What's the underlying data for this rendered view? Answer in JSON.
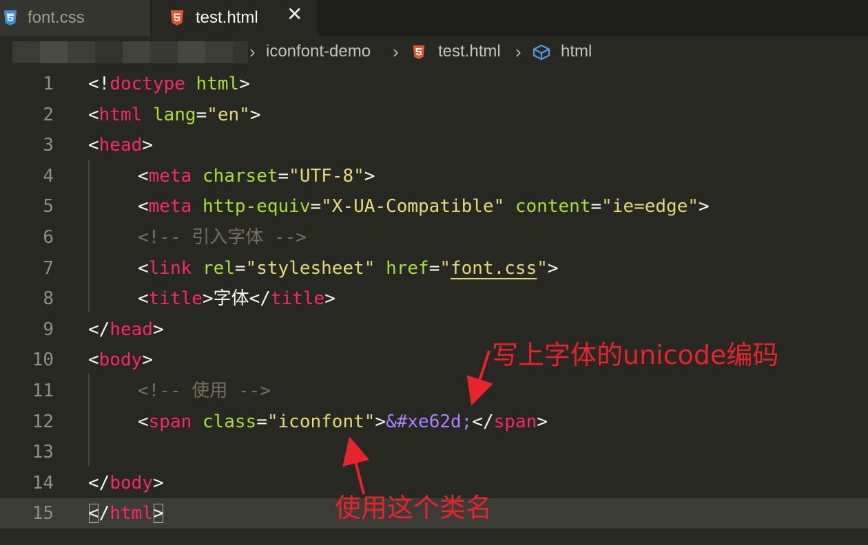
{
  "tabs": [
    {
      "label": "font.css",
      "icon": "css3-icon",
      "active": false
    },
    {
      "label": "test.html",
      "icon": "html5-icon",
      "active": true
    }
  ],
  "tab_close_glyph": "✕",
  "breadcrumb": {
    "items": [
      "iconfont-demo",
      "test.html",
      "html"
    ],
    "separator": "›"
  },
  "code_lines": [
    {
      "n": "1",
      "indent": 0,
      "tokens": [
        [
          "br",
          "<!"
        ],
        [
          "tag",
          "doctype"
        ],
        [
          "txt",
          " "
        ],
        [
          "attr",
          "html"
        ],
        [
          "br",
          ">"
        ]
      ]
    },
    {
      "n": "2",
      "indent": 0,
      "tokens": [
        [
          "br",
          "<"
        ],
        [
          "tag",
          "html"
        ],
        [
          "txt",
          " "
        ],
        [
          "attr",
          "lang"
        ],
        [
          "br",
          "="
        ],
        [
          "str",
          "\"en\""
        ],
        [
          "br",
          ">"
        ]
      ]
    },
    {
      "n": "3",
      "indent": 0,
      "tokens": [
        [
          "br",
          "<"
        ],
        [
          "tag",
          "head"
        ],
        [
          "br",
          ">"
        ]
      ]
    },
    {
      "n": "4",
      "indent": 1,
      "tokens": [
        [
          "br",
          "<"
        ],
        [
          "tag",
          "meta"
        ],
        [
          "txt",
          " "
        ],
        [
          "attr",
          "charset"
        ],
        [
          "br",
          "="
        ],
        [
          "str",
          "\"UTF-8\""
        ],
        [
          "br",
          ">"
        ]
      ]
    },
    {
      "n": "5",
      "indent": 1,
      "tokens": [
        [
          "br",
          "<"
        ],
        [
          "tag",
          "meta"
        ],
        [
          "txt",
          " "
        ],
        [
          "attr",
          "http-equiv"
        ],
        [
          "br",
          "="
        ],
        [
          "str",
          "\"X-UA-Compatible\""
        ],
        [
          "txt",
          " "
        ],
        [
          "attr",
          "content"
        ],
        [
          "br",
          "="
        ],
        [
          "str",
          "\"ie=edge\""
        ],
        [
          "br",
          ">"
        ]
      ]
    },
    {
      "n": "6",
      "indent": 1,
      "tokens": [
        [
          "com",
          "<!-- 引入字体 -->"
        ]
      ]
    },
    {
      "n": "7",
      "indent": 1,
      "tokens": [
        [
          "br",
          "<"
        ],
        [
          "tag",
          "link"
        ],
        [
          "txt",
          " "
        ],
        [
          "attr",
          "rel"
        ],
        [
          "br",
          "="
        ],
        [
          "str",
          "\"stylesheet\""
        ],
        [
          "txt",
          " "
        ],
        [
          "attr",
          "href"
        ],
        [
          "br",
          "="
        ],
        [
          "str",
          "\""
        ],
        [
          "strlink",
          "font.css"
        ],
        [
          "str",
          "\""
        ],
        [
          "br",
          ">"
        ]
      ]
    },
    {
      "n": "8",
      "indent": 1,
      "tokens": [
        [
          "br",
          "<"
        ],
        [
          "tag",
          "title"
        ],
        [
          "br",
          ">"
        ],
        [
          "txt",
          "字体"
        ],
        [
          "br",
          "</"
        ],
        [
          "tag",
          "title"
        ],
        [
          "br",
          ">"
        ]
      ]
    },
    {
      "n": "9",
      "indent": 0,
      "tokens": [
        [
          "br",
          "</"
        ],
        [
          "tag",
          "head"
        ],
        [
          "br",
          ">"
        ]
      ]
    },
    {
      "n": "10",
      "indent": 0,
      "tokens": [
        [
          "br",
          "<"
        ],
        [
          "tag",
          "body"
        ],
        [
          "br",
          ">"
        ]
      ]
    },
    {
      "n": "11",
      "indent": 1,
      "tokens": [
        [
          "com",
          "<!-- 使用 -->"
        ]
      ]
    },
    {
      "n": "12",
      "indent": 1,
      "tokens": [
        [
          "br",
          "<"
        ],
        [
          "tag",
          "span"
        ],
        [
          "txt",
          " "
        ],
        [
          "attr",
          "class"
        ],
        [
          "br",
          "="
        ],
        [
          "str",
          "\"iconfont\""
        ],
        [
          "br",
          ">"
        ],
        [
          "ent",
          "&#xe62d;"
        ],
        [
          "br",
          "</"
        ],
        [
          "tag",
          "span"
        ],
        [
          "br",
          ">"
        ]
      ]
    },
    {
      "n": "13",
      "indent": 0,
      "tokens": []
    },
    {
      "n": "14",
      "indent": 0,
      "tokens": [
        [
          "br",
          "</"
        ],
        [
          "tag",
          "body"
        ],
        [
          "br",
          ">"
        ]
      ]
    },
    {
      "n": "15",
      "indent": 0,
      "current": true,
      "tokens": [
        [
          "brm",
          "<"
        ],
        [
          "br",
          "/"
        ],
        [
          "tag",
          "html"
        ],
        [
          "brm",
          ">"
        ]
      ]
    }
  ],
  "annotations": {
    "unicode_note": "写上字体的unicode编码",
    "classname_note": "使用这个类名",
    "color": "#e8232a"
  },
  "colors": {
    "background": "#272822",
    "tag": "#f92672",
    "attribute": "#a6e22e",
    "string": "#e6db74",
    "entity": "#ae81ff",
    "comment": "#75715e"
  }
}
